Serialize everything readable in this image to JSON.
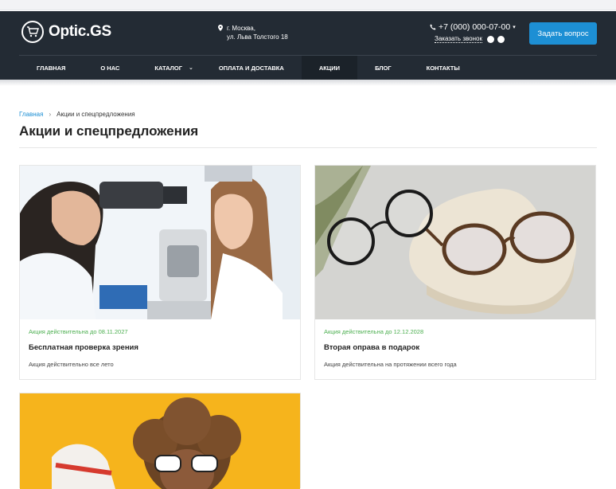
{
  "header": {
    "logo_text": "Optic.GS",
    "address_line1": "г. Москва,",
    "address_line2": "ул. Льва Толстого 18",
    "phone": "+7 (000) 000-07-00",
    "callback": "Заказать звонок",
    "ask_button": "Задать вопрос"
  },
  "nav": {
    "items": [
      {
        "label": "ГЛАВНАЯ"
      },
      {
        "label": "О НАС"
      },
      {
        "label": "КАТАЛОГ"
      },
      {
        "label": "ОПЛАТА И ДОСТАВКА"
      },
      {
        "label": "АКЦИИ"
      },
      {
        "label": "БЛОГ"
      },
      {
        "label": "КОНТАКТЫ"
      }
    ],
    "active": "АКЦИИ"
  },
  "breadcrumb": {
    "home": "Главная",
    "separator": "›",
    "current": "Акции и спецпредложения"
  },
  "page": {
    "title": "Акции и спецпредложения"
  },
  "cards": [
    {
      "valid": "Акция действительна до 08.11.2027",
      "name": "Бесплатная проверка зрения",
      "desc": "Акция действительно все лето"
    },
    {
      "valid": "Акция действительна до 12.12.2028",
      "name": "Вторая оправа в подарок",
      "desc": "Акция действительна на протяжении всего года"
    }
  ],
  "colors": {
    "header_bg": "#232b34",
    "accent": "#1d8fd4",
    "valid_green": "#4caf50"
  }
}
